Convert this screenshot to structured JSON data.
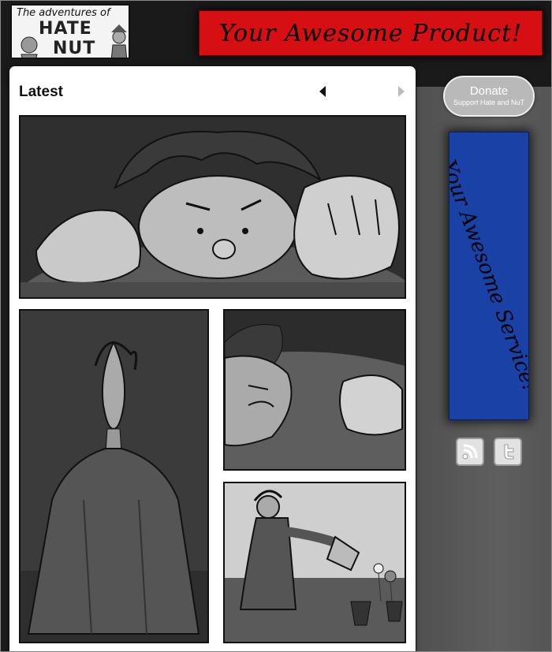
{
  "site": {
    "logo_text_top": "The adventures of",
    "logo_word_1": "HATE",
    "logo_word_2": "NUT"
  },
  "ads": {
    "top_banner": "Your Awesome Product!",
    "side_banner": "Your Awesome Service!"
  },
  "main": {
    "section_title": "Latest",
    "prev_icon": "triangle-left-icon",
    "next_icon": "triangle-right-icon"
  },
  "sidebar": {
    "donate_label": "Donate",
    "donate_sub": "Support Hate and NuT",
    "social": [
      {
        "name": "rss",
        "icon": "rss-icon"
      },
      {
        "name": "twitter",
        "icon": "twitter-icon"
      }
    ]
  },
  "colors": {
    "ad_top_bg": "#d50f12",
    "ad_side_bg": "#1941a6",
    "page_bg": "#1c1c1c"
  }
}
